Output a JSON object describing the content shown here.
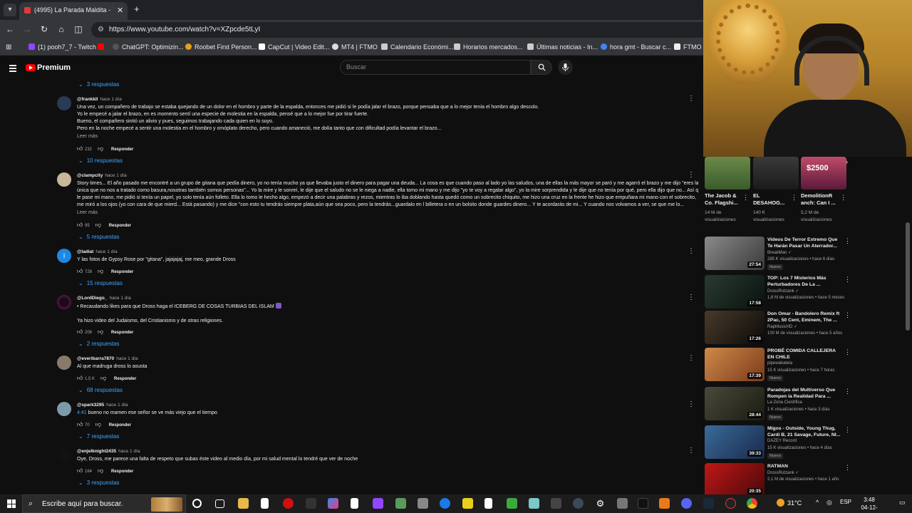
{
  "browser": {
    "tab_title": "(4995) La Parada Maldita - YouT",
    "tab_close": "✕",
    "new_tab": "+",
    "url": "https://www.youtube.com/watch?v=XZpcde5tLyI",
    "bookmarks": [
      {
        "label": "(1) pooh7_7 - Twitch",
        "color": "#9146ff"
      },
      {
        "label": "",
        "color": "#ff0000"
      },
      {
        "label": "ChatGPT: Optimizin...",
        "color": "#222"
      },
      {
        "label": "Roobet First Person...",
        "color": "#e0a020"
      },
      {
        "label": "CapCut | Video Edit...",
        "color": "#fff"
      },
      {
        "label": "MT4 | FTMO",
        "color": "#fff"
      },
      {
        "label": "Calendario Económi...",
        "color": "#ddd"
      },
      {
        "label": "Horarios mercados...",
        "color": "#ddd"
      },
      {
        "label": "Últimas noticias - In...",
        "color": "#ddd"
      },
      {
        "label": "hora gmt - Buscar c...",
        "color": "#4285f4"
      },
      {
        "label": "FTMO -",
        "color": "#fff"
      }
    ]
  },
  "youtube": {
    "logo_text": "Premium",
    "search_placeholder": "Buscar"
  },
  "comments": [
    {
      "replies_above": "3 respuestas"
    },
    {
      "author": "@frankkll",
      "when": "hace 1 día",
      "avatar_color": "#2b3a55",
      "lines": [
        "Una vez, un compañero de trabajo se estaba quejando de un dolor en el hombro y parte de la espalda, entonces me pidió si le podía jalar el brazo, porque pensaba que a lo mejor tenía el hombro algo descolo.",
        "Yo le empecé a jalar el brazo, en es momento sentí una especie de molestia en la espalda, pensé que a lo mejor fue por tirar fuerte.",
        "Bueno, el compañero sintió un alivio y pues, seguimos trabajando cada quien en lo suyo.",
        "Pero en la noche empecé a sentir una molestia en el hombro y omóplato derecho, pero cuando amaneció, me dolía tanto que con dificultad podía levantar el brazo..."
      ],
      "more": "Leer más",
      "likes": "232",
      "reply": "Responder",
      "replies": "10 respuestas"
    },
    {
      "author": "@clampcity",
      "when": "hace 1 día",
      "avatar_color": "#c9b79a",
      "lines": [
        "Story times... El año pasado me encontré a un grupo de gitana que pedía dinero, yo no tenía mucho ya que llevaba justo el dinero para pagar una deuda... La cosa es que cuando paso al lado yo las saludos, una de ellas la más mayor se paró y me agarró el brazo y me dijo \"eres la",
        "única que no nos a tratado como basura,nosotras también somos personas\"... Yo la mire y le sonreí, le dije que el saludo no se le niega a nadie, ella tomo mi mano y me dijo \"yo te voy a regalar algo\", yo la mire sorprendida y le dije que no tenía por qué, pero ella dijo que no... Así que",
        "le pase mi mano, me pidió si tenía un papel, yo solo tenía aún folleto. Ella lo tomo le hecho algo, empezó a decir una palabras y rezos, mientras lo iba doblando hasta quedó como un sobrecito chiquito, me hizo una cruz en la frente he hizo que empuñara mi mano con el sobrecito,",
        "me miró a los ojos (yo con cara de que mierd... Está pasando) y me dice \"con esto tu tendrás siempre plata,aún que sea poco, pero la tendrás...guardalo en l billetera o en un bolsito donde guardes dinero... Y te acordarás de mi... Y cuando nos volvamos a ver, se que me lo..."
      ],
      "more": "Leer más",
      "likes": "95",
      "reply": "Responder",
      "replies": "5 respuestas"
    },
    {
      "author": "@ladiat",
      "when": "hace 1 día",
      "avatar_color": "#1e88e5",
      "avatar_letter": "I",
      "lines": [
        "Y las fotos de Gypsy Rose por \"gitana\", jajajajaj, me meo, grande Dross"
      ],
      "likes": "728",
      "reply": "Responder",
      "replies": "15 respuestas"
    },
    {
      "author": "@LordDiego_",
      "when": "hace 1 día",
      "avatar_color": "#6a1b4d",
      "lines": [
        "• Recaudando likes para que Dross haga el ICEBERG DE COSAS TURBIAS DEL ISLAM",
        "",
        "Ya hizo video del Judaismo, del Cristianismo y de otras religiones."
      ],
      "likes": "206",
      "reply": "Responder",
      "replies": "2 respuestas"
    },
    {
      "author": "@everibarra7870",
      "when": "hace 1 día",
      "avatar_color": "#8a7a6a",
      "lines": [
        "Al que madruga dross lo asusta"
      ],
      "likes": "1,5 K",
      "reply": "Responder",
      "replies": "68 respuestas"
    },
    {
      "author": "@spark3295",
      "when": "hace 1 día",
      "avatar_color": "#7d9aa8",
      "timestamp": "4:41",
      "lines": [
        " bueno no mamen ese señor se ve más viejo que el tiempo"
      ],
      "likes": "70",
      "reply": "Responder",
      "replies": "7 respuestas"
    },
    {
      "author": "@enjelknight2435",
      "when": "hace 1 día",
      "avatar_color": "#111",
      "lines": [
        "Oye, Dross, me parece una falta de respeto que subas éste video al medio día, por mi salud mental lo tendré que ver de noche"
      ],
      "likes": "164",
      "reply": "Responder",
      "replies": "3 respuestas"
    }
  ],
  "shorts": [
    {
      "title": "The Jacob & Co. Flagshi...",
      "views": "14 M de visualizaciones",
      "color": "#4a6b3a",
      "overlay": ""
    },
    {
      "title": "EL DESAHOG...",
      "views": "140 K visualizaciones",
      "color": "#2a2a2a",
      "overlay": ""
    },
    {
      "title": "DemolitionR anch: Can I ...",
      "views": "5,2 M de visualizaciones",
      "color": "#8a2a4a",
      "overlay": "$2500"
    }
  ],
  "recommended": [
    {
      "title": "Videos De Terror Extremo Que Te Harán Pasar Un Aterrador...",
      "channel": "BreakMan",
      "meta": "285 K visualizaciones • hace 6 días",
      "duration": "27:54",
      "badge": "Nuevo",
      "color": "#6a6a6a"
    },
    {
      "title": "TOP: Los 7 Misterios Más Perturbadores De La ...",
      "channel": "DrossRotzank",
      "meta": "1,8 M de visualizaciones • hace 5 meses",
      "duration": "17:58",
      "badge": "",
      "color": "#1c2a24"
    },
    {
      "title": "Don Omar - Bandolero Remix ft 2Pac, 50 Cent, Eminem, The ...",
      "channel": "RapMusicHD",
      "meta": "100 M de visualizaciones • hace 5 años",
      "duration": "17:26",
      "badge": "",
      "color": "#3a2a1a"
    },
    {
      "title": "PROBÉ COMIDA CALLEJERA EN CHILE",
      "channel": "pipewakatela",
      "meta": "15 K visualizaciones • hace 7 horas",
      "duration": "17:39",
      "badge": "Nuevo",
      "color": "#b06a3a"
    },
    {
      "title": "Paradojas del Multiverso Que Rompen la Realidad Para ...",
      "channel": "La Zona Científica",
      "meta": "1 K visualizaciones • hace 3 días",
      "duration": "28:44",
      "badge": "Nuevo",
      "color": "#3a3a2a"
    },
    {
      "title": "Migos - Outside, Young Thug, Cardi B, 21 Savage, Future, NI...",
      "channel": "DAZEY Record",
      "meta": "15 K visualizaciones • hace 4 días",
      "duration": "39:33",
      "badge": "Nuevo",
      "color": "#2a4a6a"
    },
    {
      "title": "RATMAN",
      "channel": "DrossRotzank",
      "meta": "2,1 M de visualizaciones • hace 1 año",
      "duration": "20:35",
      "badge": "",
      "color": "#8a1010"
    }
  ],
  "taskbar": {
    "search_text": "Escribe aquí para buscar.",
    "temperature": "31°C",
    "language": "ESP",
    "time": "3:48",
    "date": "04-12-2025"
  }
}
